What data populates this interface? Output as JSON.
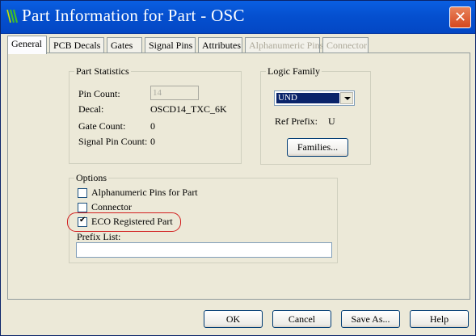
{
  "window": {
    "title": "Part Information for Part - OSC",
    "close_glyph": "✕"
  },
  "tabs": [
    {
      "label": "General",
      "state": "active"
    },
    {
      "label": "PCB Decals",
      "state": "normal"
    },
    {
      "label": "Gates",
      "state": "normal"
    },
    {
      "label": "Signal Pins",
      "state": "normal"
    },
    {
      "label": "Attributes",
      "state": "normal"
    },
    {
      "label": "Alphanumeric Pins",
      "state": "disabled"
    },
    {
      "label": "Connector",
      "state": "disabled"
    }
  ],
  "part_statistics": {
    "title": "Part Statistics",
    "pin_count_label": "Pin Count:",
    "pin_count_value": "14",
    "decal_label": "Decal:",
    "decal_value": "OSCD14_TXC_6K",
    "gate_count_label": "Gate Count:",
    "gate_count_value": "0",
    "signal_pin_count_label": "Signal Pin Count:",
    "signal_pin_count_value": "0"
  },
  "logic_family": {
    "title": "Logic Family",
    "selected": "UND",
    "ref_prefix_label": "Ref Prefix:",
    "ref_prefix_value": "U",
    "families_button": "Families..."
  },
  "options": {
    "title": "Options",
    "alphanumeric_label": "Alphanumeric Pins for Part",
    "alphanumeric_checked": false,
    "connector_label": "Connector",
    "connector_checked": false,
    "eco_label": "ECO Registered Part",
    "eco_checked": true,
    "prefix_list_label": "Prefix List:",
    "prefix_list_value": ""
  },
  "buttons": {
    "ok": "OK",
    "cancel": "Cancel",
    "save_as": "Save As...",
    "help": "Help"
  },
  "colors": {
    "title_bar": "#0550d0",
    "close": "#d6471e",
    "highlight": "#d21f1f",
    "selection": "#0a246a"
  }
}
